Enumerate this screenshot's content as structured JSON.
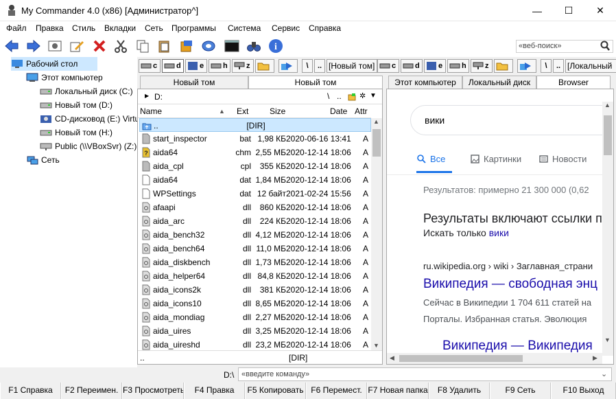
{
  "window": {
    "title": "My Commander 4.0 (x86) [Администратор^]",
    "minimize": "—",
    "maximize": "☐",
    "close": "✕"
  },
  "menu": [
    "Файл",
    "Правка",
    "Стиль",
    "Вкладки",
    "Сеть",
    "Программы",
    "Система",
    "Сервис",
    "Справка"
  ],
  "toolbar": {
    "icons": [
      "back-arrow-icon",
      "forward-arrow-icon",
      "view-icon",
      "edit-icon",
      "delete-icon",
      "cut-icon",
      "copy-icon",
      "paste-icon",
      "archive-icon",
      "network-drive-icon",
      "globe-icon",
      "console-icon",
      "binoculars-icon",
      "info-icon"
    ],
    "search_placeholder": "«веб-поиск»"
  },
  "tree": {
    "items": [
      {
        "label": "Рабочий стол",
        "icon": "desktop-icon",
        "selected": true
      },
      {
        "label": "Этот компьютер",
        "icon": "computer-icon"
      },
      {
        "label": "Локальный диск (C:)",
        "icon": "drive-icon"
      },
      {
        "label": "Новый том (D:)",
        "icon": "drive-icon"
      },
      {
        "label": "CD-дисковод (E:) VirtualBox",
        "icon": "cdrom-icon"
      },
      {
        "label": "Новый том (H:)",
        "icon": "drive-icon"
      },
      {
        "label": "Public (\\\\VBoxSvr) (Z:)",
        "icon": "network-share-icon"
      },
      {
        "label": "Сеть",
        "icon": "network-icon"
      }
    ]
  },
  "left": {
    "drives": [
      "c",
      "d",
      "e",
      "h",
      "z"
    ],
    "volume": "[Новый том]",
    "tabs": [
      "Новый том",
      "Новый том"
    ],
    "path": "D:",
    "columns": {
      "name": "Name",
      "ext": "Ext",
      "size": "Size",
      "date": "Date",
      "attr": "Attr"
    },
    "parent": {
      "name": "..",
      "dir": "[DIR]"
    },
    "files": [
      {
        "name": "start_inspector",
        "ext": "bat",
        "size": "1,98 КБ",
        "date": "2020-06-16 13:41",
        "attr": "A"
      },
      {
        "name": "aida64",
        "ext": "chm",
        "size": "2,55 МБ",
        "date": "2020-12-14 18:06",
        "attr": "A"
      },
      {
        "name": "aida_cpl",
        "ext": "cpl",
        "size": "355 КБ",
        "date": "2020-12-14 18:06",
        "attr": "A"
      },
      {
        "name": "aida64",
        "ext": "dat",
        "size": "1,84 МБ",
        "date": "2020-12-14 18:06",
        "attr": "A"
      },
      {
        "name": "WPSettings",
        "ext": "dat",
        "size": "12 байт",
        "date": "2021-02-24 15:56",
        "attr": "A"
      },
      {
        "name": "afaapi",
        "ext": "dll",
        "size": "860 КБ",
        "date": "2020-12-14 18:06",
        "attr": "A"
      },
      {
        "name": "aida_arc",
        "ext": "dll",
        "size": "224 КБ",
        "date": "2020-12-14 18:06",
        "attr": "A"
      },
      {
        "name": "aida_bench32",
        "ext": "dll",
        "size": "4,12 МБ",
        "date": "2020-12-14 18:06",
        "attr": "A"
      },
      {
        "name": "aida_bench64",
        "ext": "dll",
        "size": "11,0 МБ",
        "date": "2020-12-14 18:06",
        "attr": "A"
      },
      {
        "name": "aida_diskbench",
        "ext": "dll",
        "size": "1,73 МБ",
        "date": "2020-12-14 18:06",
        "attr": "A"
      },
      {
        "name": "aida_helper64",
        "ext": "dll",
        "size": "84,8 КБ",
        "date": "2020-12-14 18:06",
        "attr": "A"
      },
      {
        "name": "aida_icons2k",
        "ext": "dll",
        "size": "381 КБ",
        "date": "2020-12-14 18:06",
        "attr": "A"
      },
      {
        "name": "aida_icons10",
        "ext": "dll",
        "size": "8,65 МБ",
        "date": "2020-12-14 18:06",
        "attr": "A"
      },
      {
        "name": "aida_mondiag",
        "ext": "dll",
        "size": "2,27 МБ",
        "date": "2020-12-14 18:06",
        "attr": "A"
      },
      {
        "name": "aida_uires",
        "ext": "dll",
        "size": "3,25 МБ",
        "date": "2020-12-14 18:06",
        "attr": "A"
      },
      {
        "name": "aida_uireshd",
        "ext": "dll",
        "size": "23,2 МБ",
        "date": "2020-12-14 18:06",
        "attr": "A"
      }
    ],
    "footer": {
      "left": "..",
      "right": "[DIR]"
    }
  },
  "right": {
    "drives": [
      "c",
      "d",
      "e",
      "h",
      "z"
    ],
    "volume": "[Локальный",
    "tabs": [
      "Этот компьютер",
      "Локальный диск",
      "Browser"
    ],
    "browser": {
      "query": "вики",
      "tabs": [
        "Все",
        "Картинки",
        "Новости"
      ],
      "results_count": "Результатов: примерно 21 300 000 (0,62",
      "notice_title": "Результаты включают ссылки п",
      "notice_prefix": "Искать только ",
      "notice_link": "вики",
      "breadcrumb": "ru.wikipedia.org › wiki › Заглавная_страни",
      "result_title": "Википедия — свободная энц",
      "snippet1": "Сейчас в Википедии 1 704 611 статей на",
      "snippet2": "Порталы. Избранная статья. Эволюция",
      "result_title2": "Википедия — Википедия"
    }
  },
  "command": {
    "path": "D:\\",
    "placeholder": "«введите команду»"
  },
  "fkeys": [
    "F1 Справка",
    "F2 Переимен.",
    "F3 Просмотреть",
    "F4 Правка",
    "F5 Копировать",
    "F6 Перемест.",
    "F7 Новая папка",
    "F8 Удалить",
    "F9 Сеть",
    "F10 Выход"
  ],
  "colors": {
    "accent": "#1a0dab",
    "select": "#cce8ff",
    "toolbar_blue": "#1e5bd3"
  }
}
